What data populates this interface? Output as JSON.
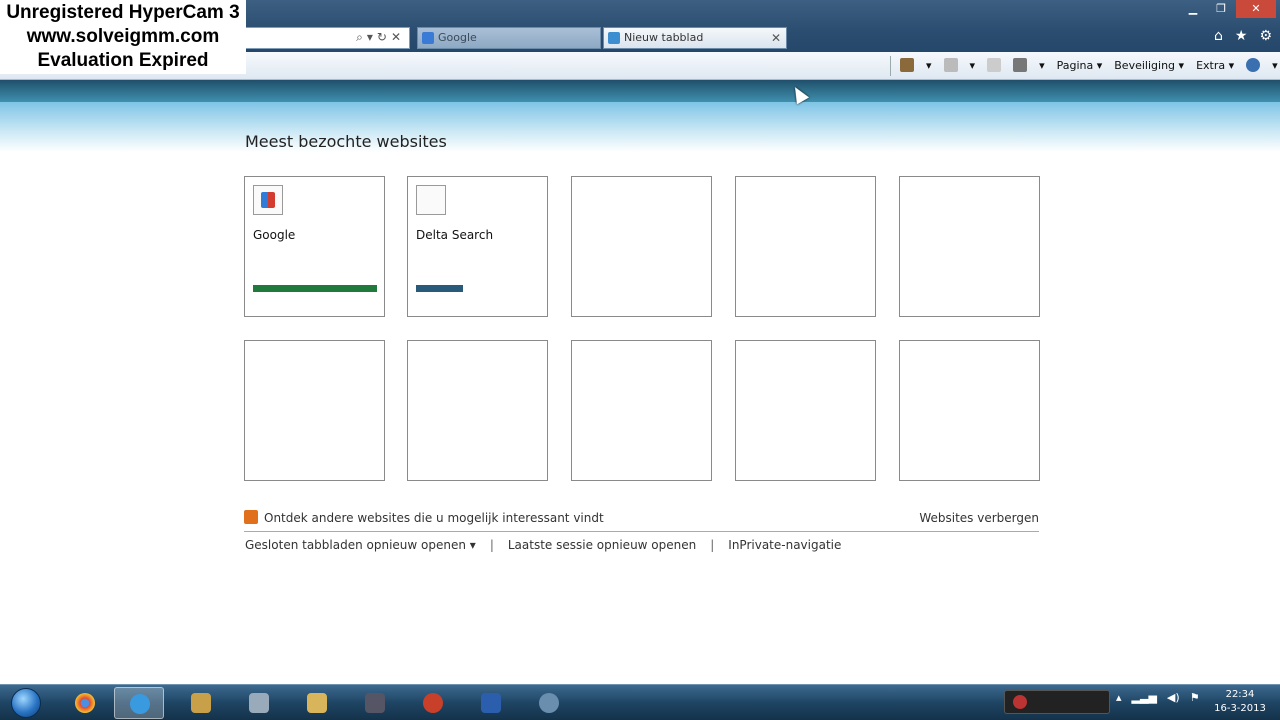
{
  "watermark": {
    "line1": "Unregistered HyperCam 3",
    "line2": "www.solveigmm.com",
    "line3": "Evaluation Expired"
  },
  "browser": {
    "tabs": [
      {
        "label": "Google",
        "active": false
      },
      {
        "label": "Nieuw tabblad",
        "active": true
      }
    ],
    "commands": {
      "page": "Pagina",
      "security": "Beveiliging",
      "extra": "Extra"
    }
  },
  "newtab": {
    "heading": "Meest bezochte websites",
    "tiles": [
      {
        "label": "Google",
        "bar_color": "#1f7a3c",
        "bar_fraction": 0.9
      },
      {
        "label": "Delta Search",
        "bar_color": "#2a5a7a",
        "bar_fraction": 0.35
      },
      {
        "label": ""
      },
      {
        "label": ""
      },
      {
        "label": ""
      },
      {
        "label": ""
      },
      {
        "label": ""
      },
      {
        "label": ""
      },
      {
        "label": ""
      },
      {
        "label": ""
      }
    ],
    "discover_text": "Ontdek andere websites die u mogelijk interessant vindt",
    "hide_sites": "Websites verbergen",
    "links": {
      "reopen_closed": "Gesloten tabbladen opnieuw openen",
      "reopen_session": "Laatste sessie opnieuw openen",
      "inprivate": "InPrivate-navigatie"
    }
  },
  "taskbar": {
    "time": "22:34",
    "date": "16-3-2013"
  }
}
